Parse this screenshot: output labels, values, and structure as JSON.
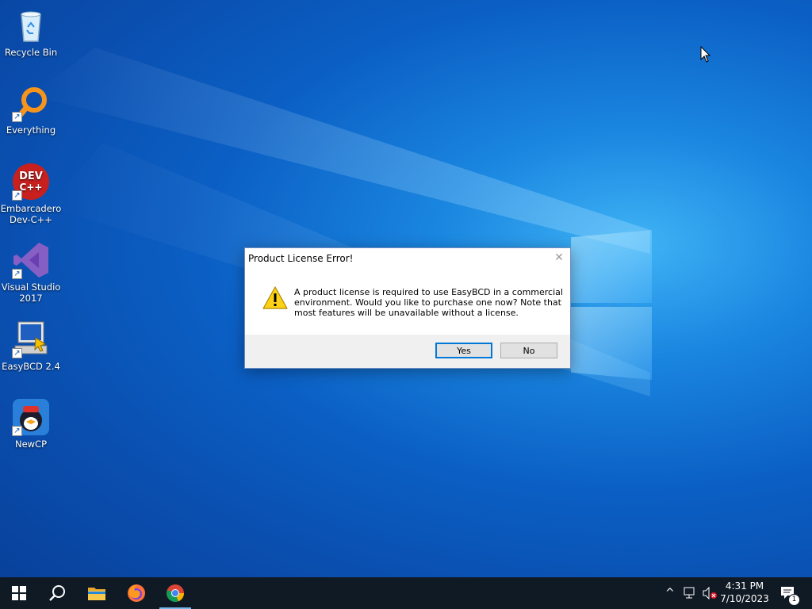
{
  "desktop": {
    "icons": [
      {
        "label": "Recycle Bin"
      },
      {
        "label": "Everything"
      },
      {
        "label": "Embarcadero Dev-C++"
      },
      {
        "label": "Visual Studio 2017"
      },
      {
        "label": "EasyBCD 2.4"
      },
      {
        "label": "NewCP"
      }
    ]
  },
  "dialog": {
    "title": "Product License Error!",
    "message": "A product license is required to use EasyBCD in a commercial environment. Would you like to purchase one now? Note that most features will be unavailable without a license.",
    "yes_label": "Yes",
    "no_label": "No"
  },
  "taskbar": {
    "start_icon": "windows-logo-icon",
    "search_icon": "search-icon",
    "pinned": [
      "file-explorer-icon",
      "firefox-icon",
      "chrome-icon"
    ],
    "active_app": "chrome",
    "time": "4:31 PM",
    "date": "7/10/2023",
    "notification_count": "1"
  },
  "colors": {
    "accent": "#0078d7",
    "taskbar": "#101a24",
    "desktop": "#0b5fc4"
  }
}
